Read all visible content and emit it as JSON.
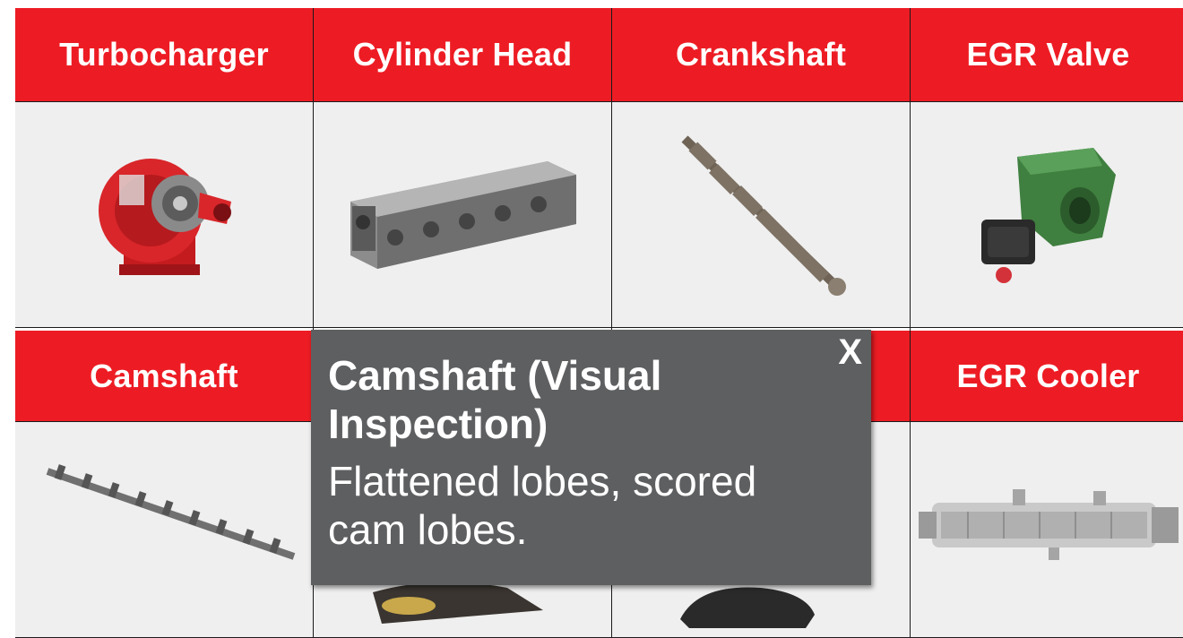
{
  "grid": {
    "row1": {
      "headers": [
        "Turbocharger",
        "Cylinder Head",
        "Crankshaft",
        "EGR Valve"
      ]
    },
    "row2": {
      "headers": [
        "Camshaft",
        "",
        "",
        "EGR Cooler"
      ]
    }
  },
  "popup": {
    "title": "Camshaft (Visual Inspection)",
    "body": "Flattened lobes, scored cam lobes.",
    "close_label": "X"
  },
  "colors": {
    "header_red": "#ed1c24",
    "cell_bg": "#efefef",
    "popup_bg": "#5e5f61"
  }
}
